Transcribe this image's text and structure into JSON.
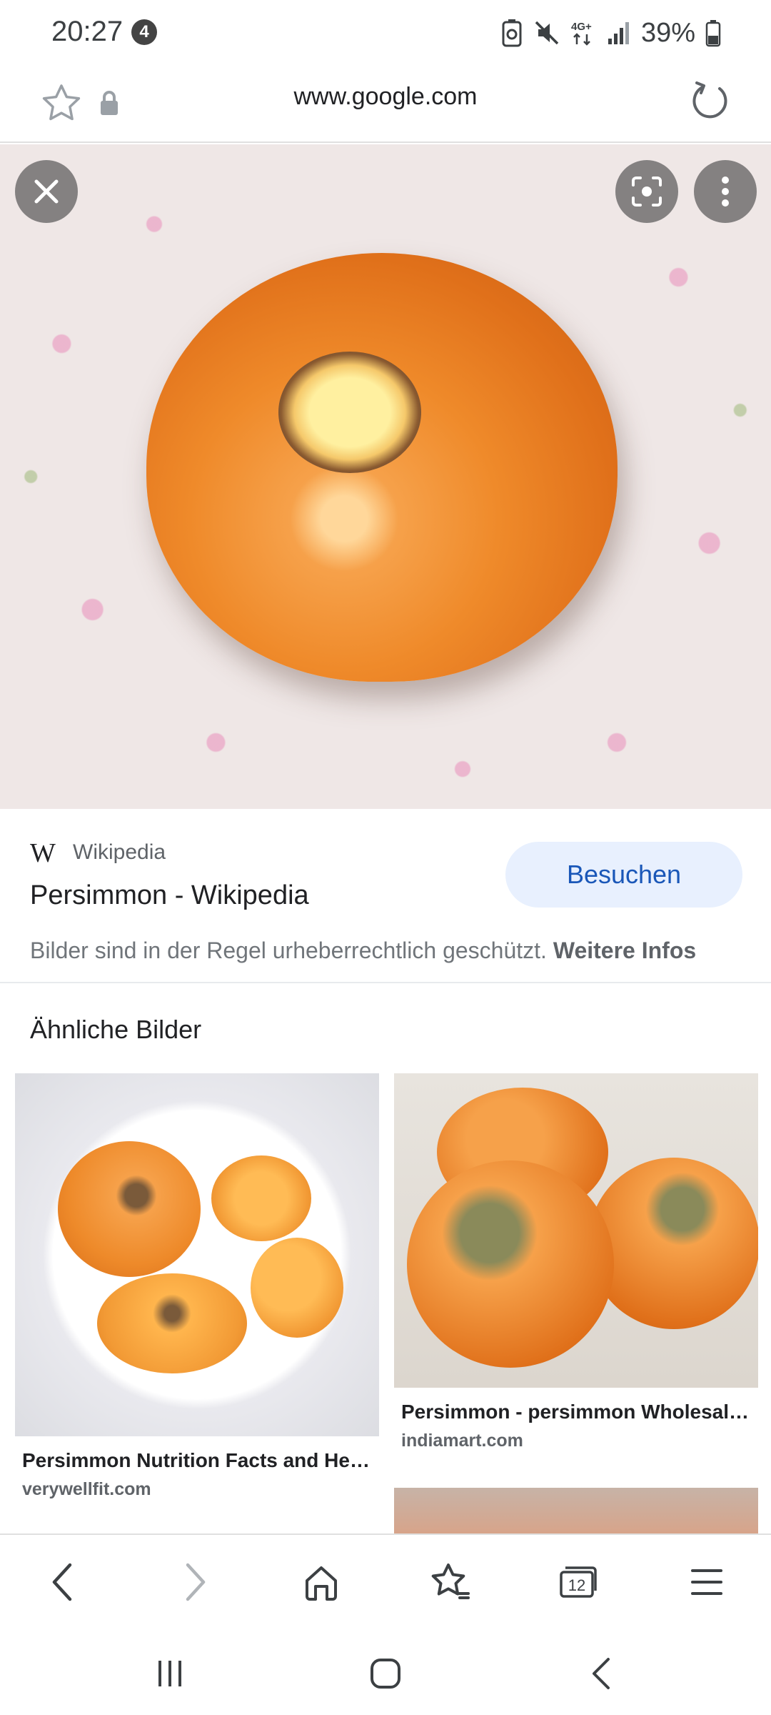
{
  "status_bar": {
    "time": "20:27",
    "notification_count": "4",
    "network": "4G+",
    "battery": "39%"
  },
  "url_bar": {
    "url": "www.google.com"
  },
  "source": {
    "site_name": "Wikipedia",
    "logo_text": "W",
    "title": "Persimmon - Wikipedia",
    "visit_label": "Besuchen",
    "copyright_text": "Bilder sind in der Regel urheberrechtlich geschützt.",
    "more_info_label": "Weitere Infos"
  },
  "similar": {
    "heading": "Ähnliche Bilder",
    "items": [
      {
        "title": "Persimmon Nutrition Facts and He…",
        "domain": "verywellfit.com"
      },
      {
        "title": "Persimmon - persimmon Wholesal…",
        "domain": "indiamart.com"
      }
    ]
  },
  "bottom_nav": {
    "tab_count": "12"
  },
  "colors": {
    "accent": "#1a57b8",
    "visit_bg": "#e8f0fe",
    "fruit": "#ef8a2a"
  }
}
